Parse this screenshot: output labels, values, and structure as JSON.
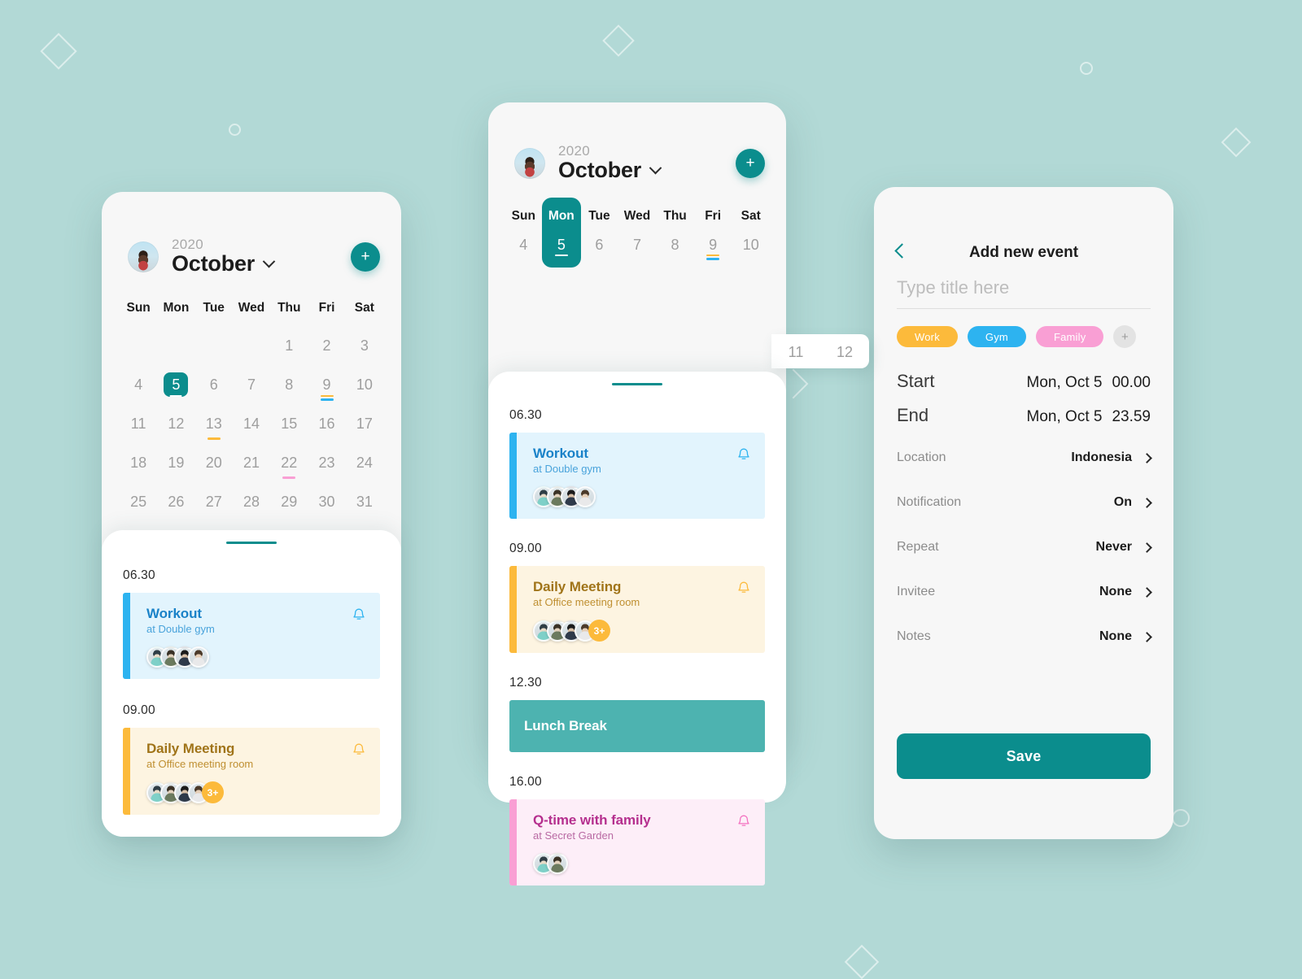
{
  "theme": {
    "background": "#b2d9d6",
    "teal": "#0b8d8d",
    "teal_soft": "#4db3b0",
    "amber": "#fcba3b",
    "blue": "#2db3f0",
    "pink": "#f99fd4"
  },
  "screen_month": {
    "header": {
      "year": "2020",
      "month": "October",
      "add_label": "+",
      "avatar_name": "user-avatar"
    },
    "weekday_headers": [
      "Sun",
      "Mon",
      "Tue",
      "Wed",
      "Thu",
      "Fri",
      "Sat"
    ],
    "weeks": [
      [
        {
          "d": ""
        },
        {
          "d": ""
        },
        {
          "d": ""
        },
        {
          "d": ""
        },
        {
          "d": "1"
        },
        {
          "d": "2"
        },
        {
          "d": "3"
        }
      ],
      [
        {
          "d": "4"
        },
        {
          "d": "5",
          "selected": true
        },
        {
          "d": "6"
        },
        {
          "d": "7"
        },
        {
          "d": "8"
        },
        {
          "d": "9",
          "marks": [
            "#fcba3b",
            "#2db3f0"
          ]
        },
        {
          "d": "10"
        }
      ],
      [
        {
          "d": "11"
        },
        {
          "d": "12"
        },
        {
          "d": "13",
          "marks": [
            "#fcba3b"
          ]
        },
        {
          "d": "14"
        },
        {
          "d": "15"
        },
        {
          "d": "16"
        },
        {
          "d": "17"
        }
      ],
      [
        {
          "d": "18"
        },
        {
          "d": "19"
        },
        {
          "d": "20"
        },
        {
          "d": "21"
        },
        {
          "d": "22",
          "marks": [
            "#f99fd4"
          ]
        },
        {
          "d": "23"
        },
        {
          "d": "24"
        }
      ],
      [
        {
          "d": "25"
        },
        {
          "d": "26"
        },
        {
          "d": "27"
        },
        {
          "d": "28"
        },
        {
          "d": "29"
        },
        {
          "d": "30"
        },
        {
          "d": "31"
        }
      ]
    ],
    "agenda": [
      {
        "time": "06.30",
        "title": "Workout",
        "location": "at Double gym",
        "bar_color": "#2db3f0",
        "bg_color": "#e2f4fd",
        "title_color": "#1a82c8",
        "sub_color": "#49a3db",
        "bell_color": "#2db3f0",
        "attendees": 4,
        "more": null
      },
      {
        "time": "09.00",
        "title": "Daily Meeting",
        "location": "at Office meeting room",
        "bar_color": "#fcba3b",
        "bg_color": "#fdf4e1",
        "title_color": "#a07419",
        "sub_color": "#bf8f31",
        "bell_color": "#fcba3b",
        "attendees": 4,
        "more": "3+"
      }
    ]
  },
  "screen_week": {
    "header": {
      "year": "2020",
      "month": "October",
      "add_label": "+"
    },
    "week_days": [
      {
        "dow": "Sun",
        "d": "4"
      },
      {
        "dow": "Mon",
        "d": "5",
        "selected": true
      },
      {
        "dow": "Tue",
        "d": "6"
      },
      {
        "dow": "Wed",
        "d": "7"
      },
      {
        "dow": "Thu",
        "d": "8"
      },
      {
        "dow": "Fri",
        "d": "9",
        "marks": [
          "#fcba3b",
          "#2db3f0"
        ]
      },
      {
        "dow": "Sat",
        "d": "10"
      }
    ],
    "overflow_days": [
      "11",
      "12"
    ],
    "agenda": [
      {
        "time": "06.30",
        "title": "Workout",
        "location": "at Double gym",
        "bar_color": "#2db3f0",
        "bg_color": "#e2f4fd",
        "title_color": "#1a82c8",
        "sub_color": "#49a3db",
        "bell_color": "#2db3f0",
        "attendees": 4,
        "more": null
      },
      {
        "time": "09.00",
        "title": "Daily Meeting",
        "location": "at Office meeting room",
        "bar_color": "#fcba3b",
        "bg_color": "#fdf4e1",
        "title_color": "#a07419",
        "sub_color": "#bf8f31",
        "bell_color": "#fcba3b",
        "attendees": 4,
        "more": "3+"
      },
      {
        "time": "12.30",
        "title": "Lunch Break",
        "location": null,
        "solid": true,
        "bg_color": "#4db3b0",
        "title_color": "#ffffff",
        "attendees": 0,
        "more": null
      },
      {
        "time": "16.00",
        "title": "Q-time with family",
        "location": "at Secret Garden",
        "bar_color": "#f99fd4",
        "bg_color": "#fdeef8",
        "title_color": "#b52f8e",
        "sub_color": "#b96aa3",
        "bell_color": "#f471c0",
        "attendees": 2,
        "more": null
      }
    ]
  },
  "screen_add_event": {
    "back_icon": "chevron-left-icon",
    "title": "Add new event",
    "title_input": {
      "value": "",
      "placeholder": "Type title here"
    },
    "categories": [
      {
        "label": "Work",
        "color": "#fcba3b"
      },
      {
        "label": "Gym",
        "color": "#2db3f0"
      },
      {
        "label": "Family",
        "color": "#f99fd4"
      }
    ],
    "add_category_label": "+",
    "datetimes": [
      {
        "label": "Start",
        "date": "Mon, Oct 5",
        "time": "00.00"
      },
      {
        "label": "End",
        "date": "Mon, Oct 5",
        "time": "23.59"
      }
    ],
    "options": [
      {
        "label": "Location",
        "value": "Indonesia"
      },
      {
        "label": "Notification",
        "value": "On"
      },
      {
        "label": "Repeat",
        "value": "Never"
      },
      {
        "label": "Invitee",
        "value": "None"
      },
      {
        "label": "Notes",
        "value": "None"
      }
    ],
    "save_label": "Save"
  }
}
